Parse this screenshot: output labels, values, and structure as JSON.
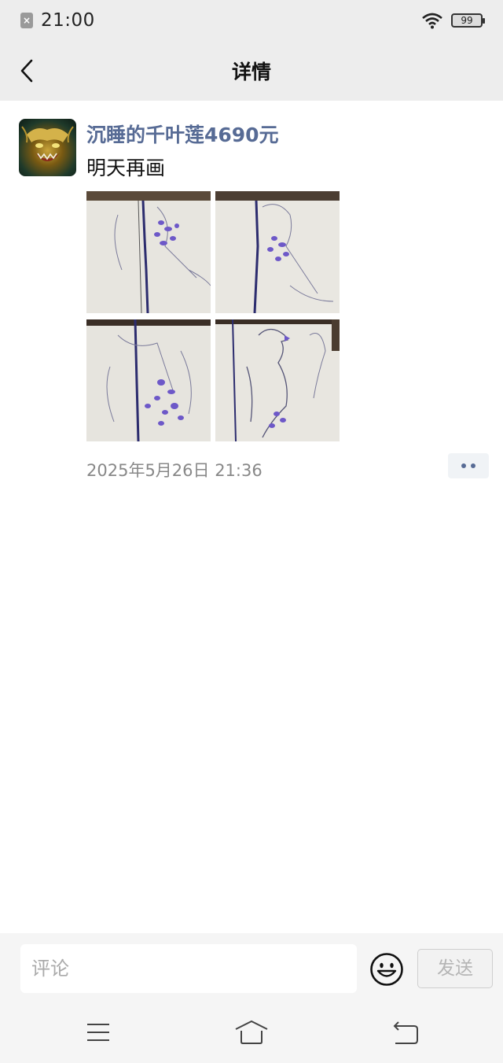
{
  "status_bar": {
    "time": "21:00",
    "battery": "99"
  },
  "nav": {
    "title": "详情"
  },
  "post": {
    "username": "沉睡的千叶莲4690元",
    "text": "明天再画",
    "timestamp": "2025年5月26日 21:36",
    "photos": [
      "photo-1",
      "photo-2",
      "photo-3",
      "photo-4"
    ]
  },
  "comment": {
    "placeholder": "评论",
    "send_label": "发送"
  },
  "colors": {
    "link": "#576b95",
    "bar_bg": "#ededed",
    "bottom_bg": "#f5f5f5"
  }
}
